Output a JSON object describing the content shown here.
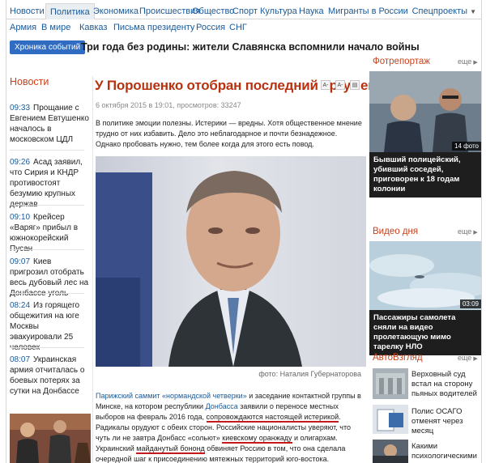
{
  "nav": {
    "primary": [
      "Новости",
      "Политика",
      "Экономика",
      "Происшествия",
      "Общество",
      "Спорт",
      "Культура",
      "Наука",
      "Мигранты в России"
    ],
    "active": "Политика",
    "special": "Спецпроекты",
    "secondary": [
      "Армия",
      "В мире",
      "Кавказ",
      "Письма президенту",
      "Россия",
      "СНГ"
    ]
  },
  "chronicle": {
    "label": "Хроника событий",
    "headline": "Три года без родины: жители Славянска вспомнили начало войны"
  },
  "news": {
    "heading": "Новости",
    "items": [
      {
        "time": "09:33",
        "text": "Прощание с Евгением Евтушенко началось в московском ЦДЛ"
      },
      {
        "time": "09:26",
        "text": "Асад заявил, что Сирия и КНДР противостоят безумию крупных держав"
      },
      {
        "time": "09:10",
        "text": "Крейсер «Варяг» прибыл в южнокорейский Пусан"
      },
      {
        "time": "09:07",
        "text": "Киев пригрозил отобрать весь дубовый лес на Донбассе уголь"
      },
      {
        "time": "08:24",
        "text": "Из горящего общежития на юге Москвы эвакуировали 25 человек"
      },
      {
        "time": "08:07",
        "text": "Украинская армия отчиталась о боевых потерях за сутки на Донбассе"
      }
    ]
  },
  "article": {
    "title": "У Порошенко отобран последний аргумент",
    "tools": [
      "A-",
      "A-",
      "print-icon"
    ],
    "meta": "6 октября 2015 в 19:01, просмотров: 33247",
    "lead": "В политике эмоции полезны. Истерики — вредны. Хотя общественное мнение трудно от них избавить. Дело это неблагодарное и почти безнадежное. Однако пробовать нужно, тем более когда для этого есть повод.",
    "photo_caption": "фото: Наталия Губернаторова",
    "body": {
      "link1": "Парижский саммит «нормандской четверки»",
      "p1": " и заседание контактной группы в Минске, на котором республики ",
      "link2": "Донбасса",
      "p2": " заявили о переносе местных выборов на февраль 2016 года, ",
      "u1": "сопровождаются настоящей истерикой",
      "p3": ". Радикалы орудуют с обеих сторон. Российские националисты уверяют, что чуть ли не завтра Донбасс «сольют» ",
      "u2": "киевскому оранжаду",
      "p4": " и олигархам. Украинский ",
      "u3": "майданутый бононд",
      "p5": " обвиняет Россию в том, что она сделала очередной шаг к присоединению мятежных территорий юго-востока."
    }
  },
  "right": {
    "photo_report": {
      "heading": "Фотрепортаж",
      "more": "еще",
      "badge": "14 фото",
      "caption": "Бывший полицейский, убивший соседей, приговорен к 18 годам колонии"
    },
    "video": {
      "heading": "Видео дня",
      "more": "еще",
      "badge": "03:09",
      "caption": "Пассажиры самолета сняли на видео пролетающую мимо тарелку НЛО"
    },
    "auto": {
      "heading": "АвтоВзгляд",
      "more": "еще",
      "items": [
        "Верховный суд встал на сторону пьяных водителей",
        "Полис ОСАГО отменят через месяц",
        "Какими психологическими"
      ]
    }
  },
  "colors": {
    "accent": "#c8421c",
    "link": "#1a5a9a",
    "chronicle": "#2f6cc2"
  }
}
